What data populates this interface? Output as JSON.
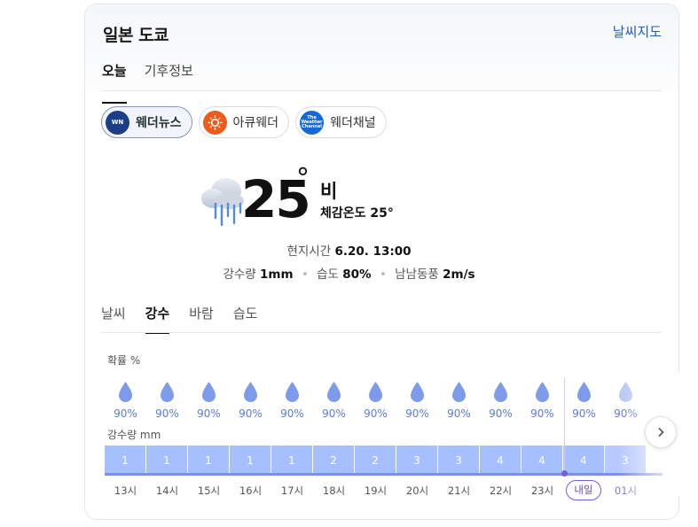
{
  "header": {
    "location": "일본 도쿄",
    "map_link": "날씨지도"
  },
  "top_tabs": [
    {
      "label": "오늘",
      "active": true
    },
    {
      "label": "기후정보",
      "active": false
    }
  ],
  "providers": [
    {
      "label": "웨더뉴스",
      "logo": "weathernews-logo",
      "active": true
    },
    {
      "label": "아큐웨더",
      "logo": "accuweather-logo",
      "active": false
    },
    {
      "label": "웨더채널",
      "logo": "weather-channel-logo",
      "active": false
    }
  ],
  "current": {
    "temperature": "25",
    "degree": "°",
    "condition": "비",
    "feels_like_label": "체감온도",
    "feels_like_value": "25°",
    "local_time_label": "현지시간",
    "local_time_value": "6.20. 13:00",
    "precip_label": "강수량",
    "precip_value": "1mm",
    "humidity_label": "습도",
    "humidity_value": "80%",
    "wind_label": "남남동풍",
    "wind_value": "2m/s",
    "icon": "cloud-rain-icon"
  },
  "sub_tabs": [
    {
      "label": "날씨",
      "active": false
    },
    {
      "label": "강수",
      "active": true
    },
    {
      "label": "바람",
      "active": false
    },
    {
      "label": "습도",
      "active": false
    }
  ],
  "hourly": {
    "prob_label": "확률 %",
    "amount_label": "강수량 mm",
    "hours": [
      {
        "time": "13시",
        "prob": "90%",
        "amount": "1"
      },
      {
        "time": "14시",
        "prob": "90%",
        "amount": "1"
      },
      {
        "time": "15시",
        "prob": "90%",
        "amount": "1"
      },
      {
        "time": "16시",
        "prob": "90%",
        "amount": "1"
      },
      {
        "time": "17시",
        "prob": "90%",
        "amount": "1"
      },
      {
        "time": "18시",
        "prob": "90%",
        "amount": "2"
      },
      {
        "time": "19시",
        "prob": "90%",
        "amount": "2"
      },
      {
        "time": "20시",
        "prob": "90%",
        "amount": "3"
      },
      {
        "time": "21시",
        "prob": "90%",
        "amount": "3"
      },
      {
        "time": "22시",
        "prob": "90%",
        "amount": "4"
      },
      {
        "time": "23시",
        "prob": "90%",
        "amount": "4"
      },
      {
        "time": "내일",
        "prob": "90%",
        "amount": "4"
      },
      {
        "time": "01시",
        "prob": "90%",
        "amount": "3"
      }
    ]
  },
  "colors": {
    "accent": "#1b5fbf",
    "drop": "#7d9bea",
    "bar": "#a6c0ff",
    "tomorrow": "#7a5bd9"
  }
}
